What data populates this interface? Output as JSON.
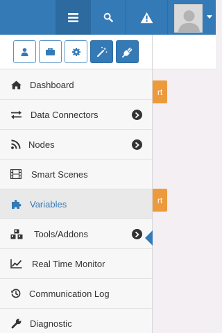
{
  "topbar": {
    "icons": [
      "menu-icon",
      "search-icon",
      "warning-icon",
      "user-avatar-icon",
      "caret-down-icon"
    ]
  },
  "shortcuts": [
    "user-icon",
    "briefcase-icon",
    "gear-icon",
    "magic-wand-icon",
    "plug-icon"
  ],
  "sidebar": {
    "items": [
      {
        "label": "Dashboard",
        "icon": "home-icon",
        "has_submenu": false,
        "active": false
      },
      {
        "label": "Data Connectors",
        "icon": "exchange-icon",
        "has_submenu": true,
        "active": false
      },
      {
        "label": "Nodes",
        "icon": "rss-icon",
        "has_submenu": true,
        "active": false
      },
      {
        "label": "Smart Scenes",
        "icon": "film-icon",
        "has_submenu": false,
        "active": false
      },
      {
        "label": "Variables",
        "icon": "puzzle-icon",
        "has_submenu": false,
        "active": true
      },
      {
        "label": "Tools/Addons",
        "icon": "cubes-icon",
        "has_submenu": true,
        "active": false
      },
      {
        "label": "Real Time Monitor",
        "icon": "line-chart-icon",
        "has_submenu": false,
        "active": false
      },
      {
        "label": "Communication Log",
        "icon": "history-icon",
        "has_submenu": false,
        "active": false
      },
      {
        "label": "Diagnostic",
        "icon": "wrench-icon",
        "has_submenu": false,
        "active": false
      }
    ]
  },
  "content": {
    "buttons": [
      {
        "label": "rt"
      },
      {
        "label": "rt"
      }
    ]
  },
  "colors": {
    "primary": "#337ab7",
    "topbar_active": "#2c6aa0",
    "orange": "#ec9a3c",
    "sidebar_bg": "#f7f7f7",
    "active_item_bg": "#e9e9e9",
    "content_bg": "#f4eff2"
  }
}
